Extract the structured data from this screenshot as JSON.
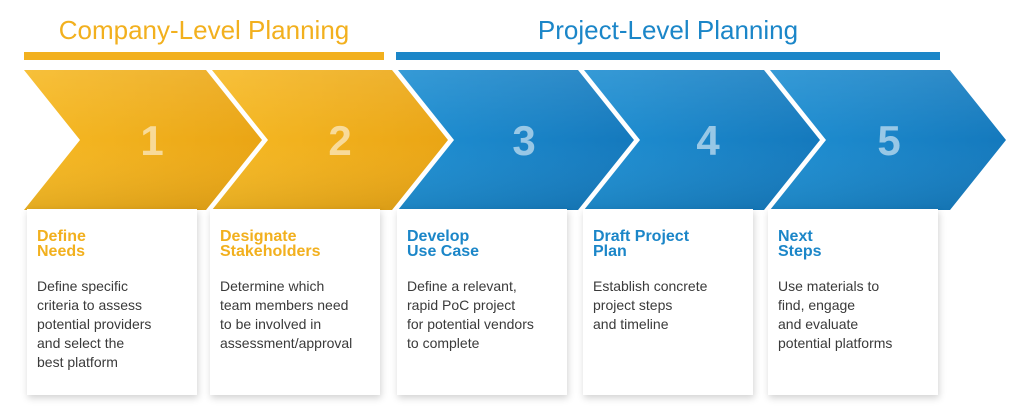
{
  "sections": {
    "company": "Company-Level Planning",
    "project": "Project-Level Planning"
  },
  "colors": {
    "gold": "#f2b01e",
    "gold_dark": "#e09a10",
    "blue": "#1b86c8",
    "blue_dark": "#0f6fb0"
  },
  "steps": [
    {
      "number": "1",
      "title": "Define\nNeeds",
      "description": "Define specific\ncriteria to assess\npotential providers\nand select the\nbest platform",
      "color": "gold"
    },
    {
      "number": "2",
      "title": "Designate\nStakeholders",
      "description": "Determine which\nteam members need\nto be involved in\nassessment/approval",
      "color": "gold"
    },
    {
      "number": "3",
      "title": "Develop\nUse Case",
      "description": "Define a relevant,\nrapid PoC project\nfor potential vendors\nto complete",
      "color": "blue"
    },
    {
      "number": "4",
      "title": "Draft Project\nPlan",
      "description": "Establish concrete\nproject steps\nand timeline",
      "color": "blue"
    },
    {
      "number": "5",
      "title": "Next\nSteps",
      "description": "Use materials to\nfind, engage\nand evaluate\npotential platforms",
      "color": "blue"
    }
  ]
}
